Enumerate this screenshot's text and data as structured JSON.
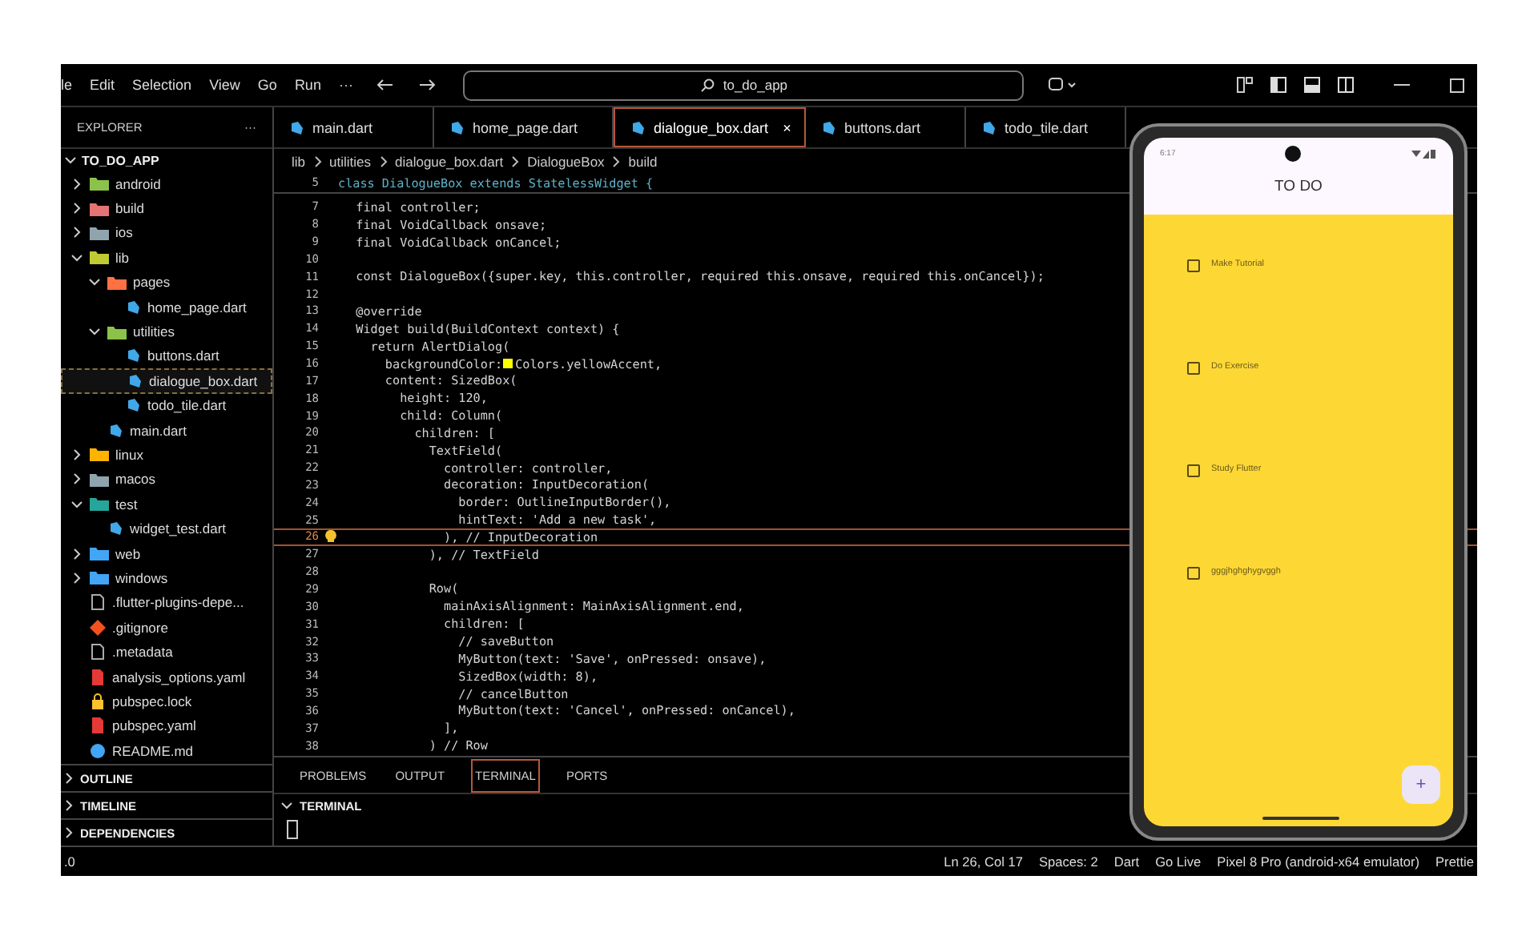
{
  "menu_bar": {
    "items": [
      "le",
      "Edit",
      "Selection",
      "View",
      "Go",
      "Run",
      "···"
    ],
    "search": {
      "value": "to_do_app"
    }
  },
  "sidebar": {
    "title": "EXPLORER",
    "more": "···",
    "project": {
      "label": "TO_DO_APP",
      "expanded": true
    },
    "tree": [
      {
        "label": "android",
        "kind": "folder",
        "color": "#8bc34a",
        "expanded": false,
        "selected": false
      },
      {
        "label": "build",
        "kind": "folder",
        "color": "#e57373",
        "expanded": false,
        "selected": false
      },
      {
        "label": "ios",
        "kind": "folder",
        "color": "#90a4ae",
        "expanded": false,
        "selected": false
      },
      {
        "label": "lib",
        "kind": "folder",
        "color": "#c0ca33",
        "expanded": true,
        "selected": false,
        "children": [
          {
            "label": "pages",
            "kind": "folder",
            "color": "#ff7043",
            "expanded": true,
            "selected": false,
            "children": [
              {
                "label": "home_page.dart",
                "kind": "dart",
                "selected": false
              }
            ]
          },
          {
            "label": "utilities",
            "kind": "folder",
            "color": "#8bc34a",
            "expanded": true,
            "selected": false,
            "children": [
              {
                "label": "buttons.dart",
                "kind": "dart",
                "selected": false
              },
              {
                "label": "dialogue_box.dart",
                "kind": "dart",
                "selected": true
              },
              {
                "label": "todo_tile.dart",
                "kind": "dart",
                "selected": false
              }
            ]
          },
          {
            "label": "main.dart",
            "kind": "dart",
            "selected": false
          }
        ]
      },
      {
        "label": "linux",
        "kind": "folder",
        "color": "#ffb300",
        "expanded": false,
        "selected": false
      },
      {
        "label": "macos",
        "kind": "folder",
        "color": "#90a4ae",
        "expanded": false,
        "selected": false
      },
      {
        "label": "test",
        "kind": "folder",
        "color": "#26a69a",
        "expanded": true,
        "selected": false,
        "children": [
          {
            "label": "widget_test.dart",
            "kind": "dart",
            "selected": false
          }
        ]
      },
      {
        "label": "web",
        "kind": "folder",
        "color": "#42a5f5",
        "expanded": false,
        "selected": false
      },
      {
        "label": "windows",
        "kind": "folder",
        "color": "#42a5f5",
        "expanded": false,
        "selected": false
      },
      {
        "label": ".flutter-plugins-depe...",
        "kind": "file",
        "selected": false
      },
      {
        "label": ".gitignore",
        "kind": "git",
        "selected": false
      },
      {
        "label": ".metadata",
        "kind": "file",
        "selected": false
      },
      {
        "label": "analysis_options.yaml",
        "kind": "yaml",
        "selected": false
      },
      {
        "label": "pubspec.lock",
        "kind": "lock",
        "selected": false
      },
      {
        "label": "pubspec.yaml",
        "kind": "yaml",
        "selected": false
      },
      {
        "label": "README.md",
        "kind": "info",
        "selected": false
      }
    ],
    "sections": [
      {
        "label": "OUTLINE",
        "expanded": false
      },
      {
        "label": "TIMELINE",
        "expanded": false
      },
      {
        "label": "DEPENDENCIES",
        "expanded": false
      }
    ]
  },
  "tabs": [
    {
      "label": "main.dart",
      "selected": false
    },
    {
      "label": "home_page.dart",
      "selected": false
    },
    {
      "label": "dialogue_box.dart",
      "selected": true,
      "close": "×"
    },
    {
      "label": "buttons.dart",
      "selected": false
    },
    {
      "label": "todo_tile.dart",
      "selected": false
    }
  ],
  "breadcrumb": [
    "lib",
    "utilities",
    "dialogue_box.dart",
    "DialogueBox",
    "build"
  ],
  "sticky_line": {
    "number": "5",
    "text": "class DialogueBox extends StatelessWidget {"
  },
  "code": [
    {
      "number": "7",
      "text": "  final controller;",
      "current": false
    },
    {
      "number": "8",
      "text": "  final VoidCallback onsave;",
      "current": false
    },
    {
      "number": "9",
      "text": "  final VoidCallback onCancel;",
      "current": false
    },
    {
      "number": "10",
      "current": false
    },
    {
      "number": "11",
      "text": "  const DialogueBox({super.key, this.controller, required this.onsave, required this.onCancel});",
      "current": false
    },
    {
      "number": "12",
      "current": false
    },
    {
      "number": "13",
      "text": "  @override",
      "current": false
    },
    {
      "number": "14",
      "text": "  Widget build(BuildContext context) {",
      "current": false
    },
    {
      "number": "15",
      "text": "    return AlertDialog(",
      "current": false
    },
    {
      "number": "16",
      "text": "      backgroundColor:",
      "swatch_text": "Colors.yellowAccent,",
      "current": false
    },
    {
      "number": "17",
      "text": "      content: SizedBox(",
      "current": false
    },
    {
      "number": "18",
      "text": "        height: 120,",
      "current": false
    },
    {
      "number": "19",
      "text": "        child: Column(",
      "current": false
    },
    {
      "number": "20",
      "text": "          children: [",
      "current": false
    },
    {
      "number": "21",
      "text": "            TextField(",
      "current": false
    },
    {
      "number": "22",
      "text": "              controller: controller,",
      "current": false
    },
    {
      "number": "23",
      "text": "              decoration: InputDecoration(",
      "current": false
    },
    {
      "number": "24",
      "text": "                border: OutlineInputBorder(),",
      "current": false
    },
    {
      "number": "25",
      "text": "                hintText: 'Add a new task',",
      "current": false
    },
    {
      "number": "26",
      "text": "              ), // InputDecoration",
      "current": true
    },
    {
      "number": "27",
      "text": "            ), // TextField",
      "current": false
    },
    {
      "number": "28",
      "current": false
    },
    {
      "number": "29",
      "text": "            Row(",
      "current": false
    },
    {
      "number": "30",
      "text": "              mainAxisAlignment: MainAxisAlignment.end,",
      "current": false
    },
    {
      "number": "31",
      "text": "              children: [",
      "current": false
    },
    {
      "number": "32",
      "text": "                // saveButton",
      "current": false
    },
    {
      "number": "33",
      "text": "                MyButton(text: 'Save', onPressed: onsave),",
      "current": false
    },
    {
      "number": "34",
      "text": "                SizedBox(width: 8),",
      "current": false
    },
    {
      "number": "35",
      "text": "                // cancelButton",
      "current": false
    },
    {
      "number": "36",
      "text": "                MyButton(text: 'Cancel', onPressed: onCancel),",
      "current": false
    },
    {
      "number": "37",
      "text": "              ],",
      "current": false
    },
    {
      "number": "38",
      "text": "            ) // Row",
      "current": false
    }
  ],
  "panel": {
    "tabs": [
      {
        "label": "PROBLEMS",
        "selected": false
      },
      {
        "label": "OUTPUT",
        "selected": false
      },
      {
        "label": "TERMINAL",
        "selected": true
      },
      {
        "label": "PORTS",
        "selected": false
      }
    ],
    "section": {
      "label": "TERMINAL",
      "expanded": true
    }
  },
  "status_bar": {
    "left": ".0",
    "items": [
      "Ln 26, Col 17",
      "Spaces: 2",
      "Dart",
      "Go Live",
      "Pixel 8 Pro (android-x64 emulator)",
      "Prettie"
    ]
  },
  "phone": {
    "time": "6:17",
    "title": "TO DO",
    "tasks": [
      {
        "label": "Make Tutorial",
        "checked": false
      },
      {
        "label": "Do Exercise",
        "checked": false
      },
      {
        "label": "Study Flutter",
        "checked": false
      },
      {
        "label": "gggjhghghygvggh",
        "checked": false
      }
    ],
    "fab": "+"
  }
}
